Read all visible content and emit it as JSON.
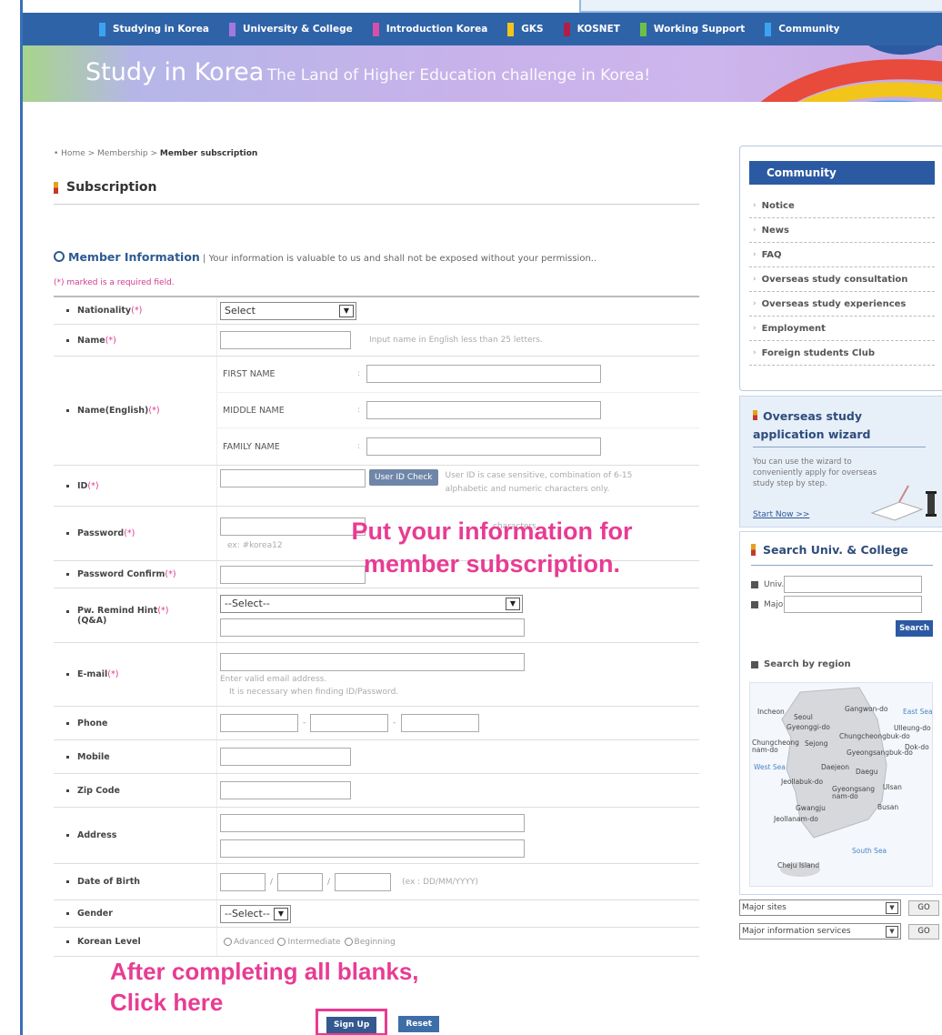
{
  "nav": {
    "items": [
      {
        "label": "Studying in Korea",
        "color": "#3ba3f0"
      },
      {
        "label": "University & College",
        "color": "#a278e0"
      },
      {
        "label": "Introduction Korea",
        "color": "#d84fa8"
      },
      {
        "label": "GKS",
        "color": "#f2c51a"
      },
      {
        "label": "KOSNET",
        "color": "#b01e47"
      },
      {
        "label": "Working Support",
        "color": "#6cc04a"
      },
      {
        "label": "Community",
        "color": "#3ba3f0"
      }
    ]
  },
  "banner": {
    "title": "Study in Korea",
    "tagline": "The Land of Higher Education challenge in Korea!"
  },
  "breadcrumb": {
    "path": "• Home > Membership > ",
    "current": "Member subscription"
  },
  "page": {
    "title": "Subscription",
    "section_title": "Member Information",
    "section_note": " | Your information is valuable to us and shall not be exposed without your permission..",
    "required_note": "(*) marked is a required field."
  },
  "form": {
    "req_mark": "(*)",
    "nationality": {
      "label": "Nationality",
      "value": "Select"
    },
    "name": {
      "label": "Name",
      "hint": "Input name in English less than 25 letters."
    },
    "name_english": {
      "label": "Name(English)",
      "first": "FIRST NAME",
      "middle": "MIDDLE NAME",
      "family": "FAMILY NAME",
      "colon": ":"
    },
    "id": {
      "label": "ID",
      "check_button": "User ID Check",
      "hint": "User ID is case sensitive, combination of 6-15 alphabetic and numeric characters only."
    },
    "password": {
      "label": "Password",
      "hint_tail": "characters..",
      "example": "ex: #korea12"
    },
    "password_confirm": {
      "label": "Password Confirm"
    },
    "pw_hint": {
      "label": "Pw. Remind Hint",
      "label2": "(Q&A)",
      "value": "--Select--"
    },
    "email": {
      "label": "E-mail",
      "hint1": "Enter valid email address.",
      "hint2": "It is necessary when finding ID/Password."
    },
    "phone": {
      "label": "Phone",
      "sep": "-"
    },
    "mobile": {
      "label": "Mobile"
    },
    "zip": {
      "label": "Zip Code"
    },
    "address": {
      "label": "Address"
    },
    "dob": {
      "label": "Date of Birth",
      "sep": "/",
      "hint": "(ex : DD/MM/YYYY)"
    },
    "gender": {
      "label": "Gender",
      "value": "--Select--"
    },
    "korean_level": {
      "label": "Korean Level",
      "options": [
        "Advanced",
        "Intermediate",
        "Beginning"
      ]
    }
  },
  "buttons": {
    "sign_up": "Sign Up",
    "reset": "Reset"
  },
  "overlays": {
    "center_line1": "Put your information for",
    "center_line2": "member subscription.",
    "bottom_line1": "After completing all blanks,",
    "bottom_line2": "Click here"
  },
  "sidebar": {
    "community": {
      "title": "Community",
      "items": [
        "Notice",
        "News",
        "FAQ",
        "Overseas study consultation",
        "Overseas study experiences",
        "Employment",
        "Foreign students Club"
      ]
    },
    "wizard": {
      "title_line1": "Overseas study",
      "title_line2": "application wizard",
      "text": "You can use the wizard to conveniently apply for overseas study step by step.",
      "link": "Start Now >>"
    },
    "search": {
      "title": "Search Univ. & College",
      "univ_label": "Univ.",
      "major_label": "Major",
      "button": "Search",
      "region_title": "Search by region"
    },
    "map_labels": {
      "incheon": "Incheon",
      "seoul": "Seoul",
      "gangwon": "Gangwon-do",
      "east_sea": "East Sea",
      "gyeonggi": "Gyeonggi-do",
      "ulleung": "Ulleung-do",
      "chungbuk": "Chungcheongbuk-do",
      "chungnam": "Chungcheong nam-do",
      "sejong": "Sejong",
      "dok": "Dok-do",
      "gyeongbuk": "Gyeongsangbuk-do",
      "west_sea": "West Sea",
      "daejeon": "Daejeon",
      "daegu": "Daegu",
      "jeonbuk": "Jeollabuk-do",
      "ulsan": "Ulsan",
      "gyeongnam": "Gyeongsang nam-do",
      "gwangju": "Gwangju",
      "busan": "Busan",
      "jeonnam": "Jeollanam-do",
      "south_sea": "South Sea",
      "jeju": "Cheju Island"
    },
    "quick": {
      "major_sites": "Major sites",
      "major_info": "Major information services",
      "go": "GO"
    }
  },
  "colors": {
    "accent_pink": "#e83c93",
    "nav_blue": "#2f63a8",
    "brand_blue": "#2b5aa3"
  }
}
